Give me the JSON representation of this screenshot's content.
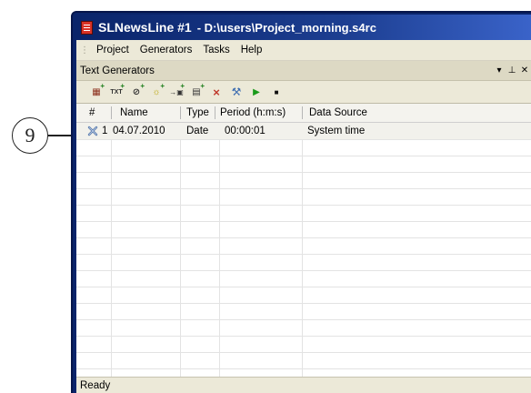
{
  "callout": {
    "number": "9"
  },
  "window": {
    "title_app": "SLNewsLine #1",
    "title_path": "- D:\\users\\Project_morning.s4rc"
  },
  "menu": {
    "items": [
      "Project",
      "Generators",
      "Tasks",
      "Help"
    ]
  },
  "panel": {
    "title": "Text Generators",
    "ctrls": [
      "▾",
      "⊥",
      "✕"
    ]
  },
  "toolbar": {
    "buttons": [
      {
        "icon": "add-image-generator-icon",
        "glyph": "▦"
      },
      {
        "icon": "add-text-generator-icon",
        "glyph": "TXT"
      },
      {
        "icon": "add-clock-generator-icon",
        "glyph": "⊘"
      },
      {
        "icon": "add-sun-generator-icon",
        "glyph": "☼"
      },
      {
        "icon": "add-import-generator-icon",
        "glyph": "→▣"
      },
      {
        "icon": "add-calendar-generator-icon",
        "glyph": "▤"
      },
      {
        "icon": "delete-icon",
        "glyph": "×"
      },
      {
        "icon": "tools-icon",
        "glyph": "⚒"
      },
      {
        "icon": "play-icon",
        "glyph": "▶"
      },
      {
        "icon": "stop-icon",
        "glyph": "■"
      }
    ]
  },
  "grid": {
    "columns": [
      "#",
      "Name",
      "Type",
      "Period (h:m:s)",
      "Data Source"
    ],
    "rows": [
      {
        "num": "1",
        "name": "04.07.2010",
        "type": "Date",
        "period": "00:00:01",
        "source": "System time"
      }
    ]
  },
  "status": {
    "text": "Ready"
  },
  "colors": {
    "titlebar": "#0a246a",
    "accent_green": "#1a7d1a",
    "row_selected": "#f2f1ec"
  }
}
